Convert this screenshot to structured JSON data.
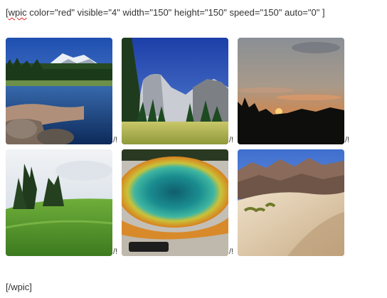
{
  "editor": {
    "shortcode_tag": "wpic",
    "shortcode_open_rest": " color=\"red\" visible=\"4\" width=\"150\" height=\"150\" speed=\"150\" auto=\"0\" ]",
    "shortcode_bracket": "[",
    "shortcode_close": "[/wpic]"
  },
  "gallery": {
    "images": [
      {
        "subject": "mountain-lake",
        "suffix": "/!"
      },
      {
        "subject": "half-dome-meadow",
        "suffix": "/!"
      },
      {
        "subject": "forest-sunset",
        "suffix": "/!"
      },
      {
        "subject": "green-hill-trees",
        "suffix": "/!"
      },
      {
        "subject": "hot-spring-pool",
        "suffix": "/!"
      },
      {
        "subject": "desert-dunes",
        "suffix": ""
      }
    ]
  }
}
